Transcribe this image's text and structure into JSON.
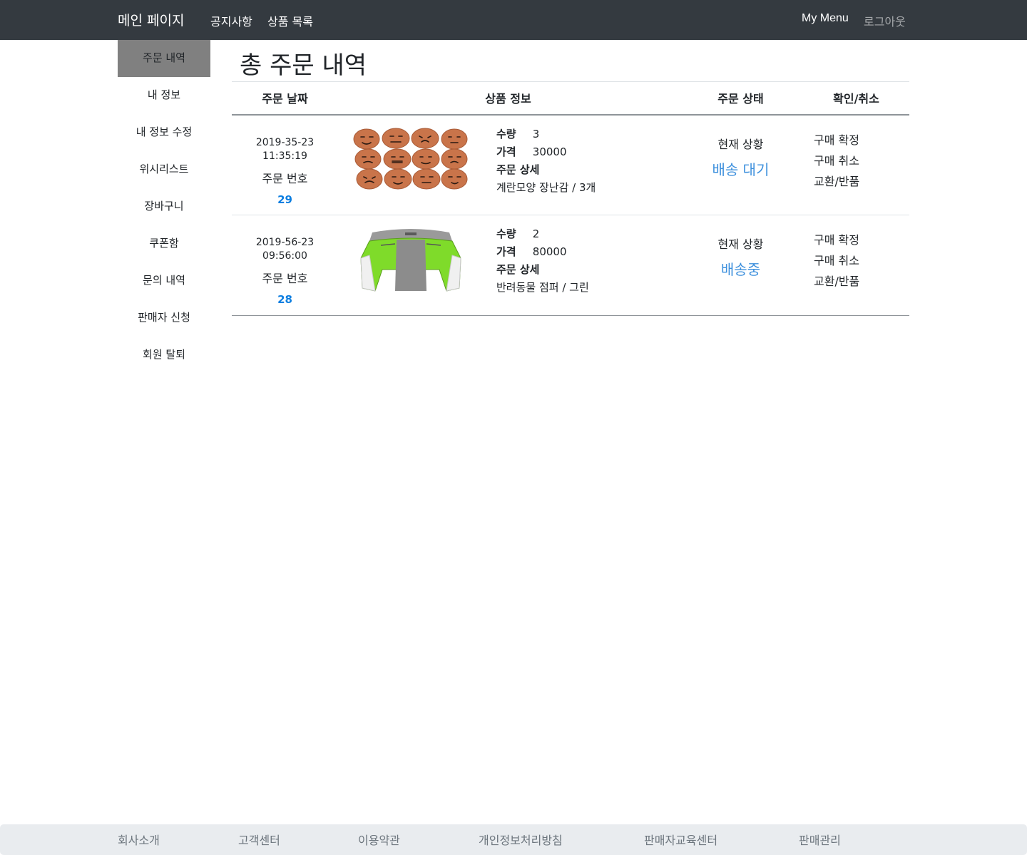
{
  "navbar": {
    "brand": "메인 페이지",
    "links": [
      "공지사항",
      "상품 목록"
    ],
    "my_menu": "My Menu",
    "logout": "로그아웃"
  },
  "sidebar": {
    "items": [
      "주문 내역",
      "내 정보",
      "내 정보 수정",
      "위시리스트",
      "장바구니",
      "쿠폰함",
      "문의 내역",
      "판매자 신청",
      "회원 탈퇴"
    ],
    "active_index": 0
  },
  "main": {
    "title": "총 주문 내역",
    "columns": [
      "주문 날짜",
      "상품 정보",
      "주문 상태",
      "확인/취소"
    ],
    "labels": {
      "order_no": "주문 번호",
      "quantity": "수량",
      "price": "가격",
      "detail": "주문 상세",
      "status": "현재 상황"
    },
    "orders": [
      {
        "date": "2019-35-23",
        "time": "11:35:19",
        "order_no": "29",
        "image_icon": "egg-faces-product-image",
        "quantity": "3",
        "price": "30000",
        "detail": "계란모양 장난감 / 3개",
        "status": "배송 대기",
        "actions": [
          "구매 확정",
          "구매 취소",
          "교환/반품"
        ]
      },
      {
        "date": "2019-56-23",
        "time": "09:56:00",
        "order_no": "28",
        "image_icon": "pet-jacket-product-image",
        "quantity": "2",
        "price": "80000",
        "detail": "반려동물 점퍼 / 그린",
        "status": "배송중",
        "actions": [
          "구매 확정",
          "구매 취소",
          "교환/반품"
        ]
      }
    ]
  },
  "footer": {
    "links": [
      "회사소개",
      "고객센터",
      "이용약관",
      "개인정보처리방침",
      "판매자교육센터",
      "판매관리"
    ]
  },
  "colors": {
    "navbar_bg": "#343a40",
    "active_sidebar_bg": "#808080",
    "order_no_color": "#0d7ee0",
    "status_color": "#3d90dd",
    "footer_bg": "#e9ecef"
  }
}
